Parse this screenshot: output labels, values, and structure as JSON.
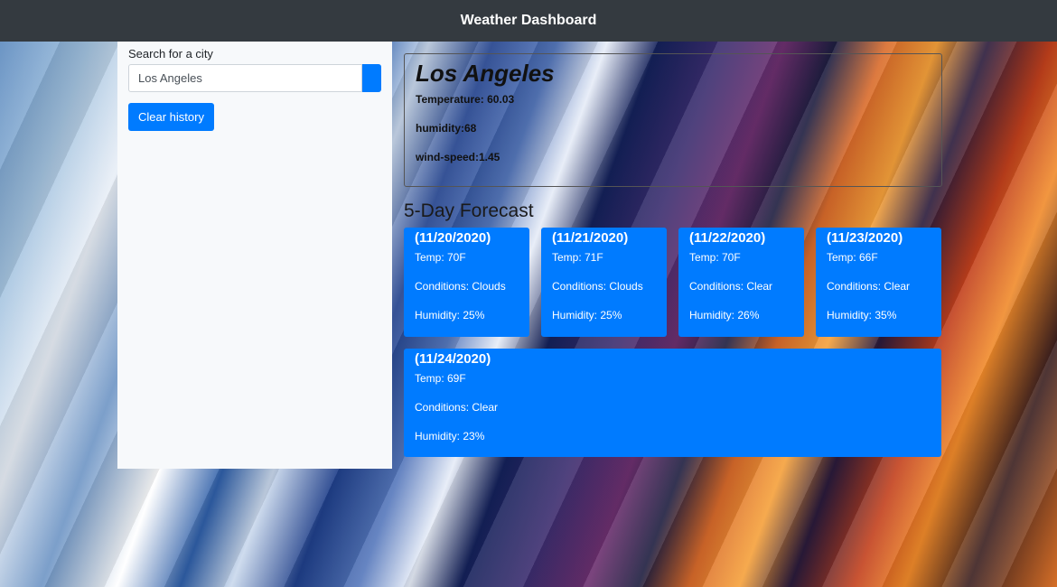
{
  "navbar": {
    "title": "Weather Dashboard"
  },
  "search": {
    "label": "Search for a city",
    "value": "Los Angeles",
    "clear_label": "Clear history"
  },
  "current": {
    "city": "Los Angeles",
    "temperature": "Temperature: 60.03",
    "humidity": "humidity:68",
    "wind": "wind-speed:1.45"
  },
  "forecast": {
    "title": "5-Day Forecast",
    "days": [
      {
        "date": "(11/20/2020)",
        "temp": "Temp: 70F",
        "conditions": "Conditions: Clouds",
        "humidity": "Humidity: 25%"
      },
      {
        "date": "(11/21/2020)",
        "temp": "Temp: 71F",
        "conditions": "Conditions: Clouds",
        "humidity": "Humidity: 25%"
      },
      {
        "date": "(11/22/2020)",
        "temp": "Temp: 70F",
        "conditions": "Conditions: Clear",
        "humidity": "Humidity: 26%"
      },
      {
        "date": "(11/23/2020)",
        "temp": "Temp: 66F",
        "conditions": "Conditions: Clear",
        "humidity": "Humidity: 35%"
      },
      {
        "date": "(11/24/2020)",
        "temp": "Temp: 69F",
        "conditions": "Conditions: Clear",
        "humidity": "Humidity: 23%"
      }
    ]
  },
  "colors": {
    "navbar": "#343a40",
    "accent": "#007bff"
  }
}
